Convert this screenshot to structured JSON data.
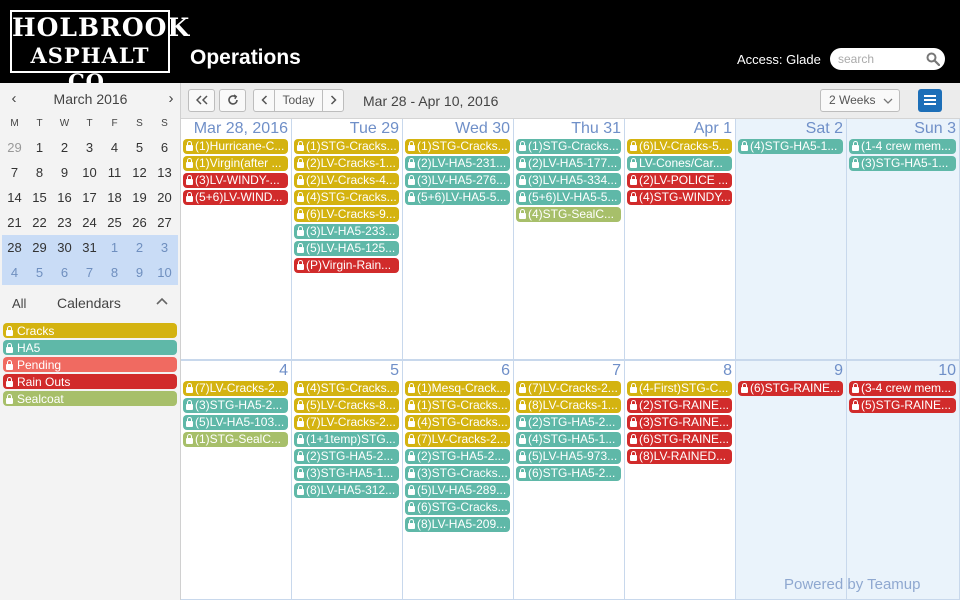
{
  "header": {
    "logo_line1": "HOLBROOK",
    "logo_line2": "ASPHALT CO.",
    "app_title": "Operations",
    "access_label": "Access: Glade",
    "search_placeholder": "search"
  },
  "colors": {
    "header_bg": "#000000",
    "primary": "#1d6fb8",
    "Cracks": "#d4b310",
    "HA5": "#5fb8a8",
    "Pending": "#f06a61",
    "Rain Outs": "#d12b2b",
    "Sealcoat": "#a7bf6a",
    "weekend_bg": "#eaf3fb",
    "day_number": "#6f8fc8"
  },
  "mini_calendar": {
    "prev_icon": "chevron-left-icon",
    "next_icon": "chevron-right-icon",
    "title": "March 2016",
    "days_of_week": [
      "M",
      "T",
      "W",
      "T",
      "F",
      "S",
      "S"
    ],
    "weeks": [
      [
        "29",
        "1",
        "2",
        "3",
        "4",
        "5",
        "6"
      ],
      [
        "7",
        "8",
        "9",
        "10",
        "11",
        "12",
        "13"
      ],
      [
        "14",
        "15",
        "16",
        "17",
        "18",
        "19",
        "20"
      ],
      [
        "21",
        "22",
        "23",
        "24",
        "25",
        "26",
        "27"
      ],
      [
        "28",
        "29",
        "30",
        "31",
        "1",
        "2",
        "3"
      ],
      [
        "4",
        "5",
        "6",
        "7",
        "8",
        "9",
        "10"
      ]
    ],
    "selected_weeks": [
      4,
      5
    ]
  },
  "calendars": {
    "all_label": "All",
    "title": "Calendars",
    "items": [
      {
        "name": "Cracks",
        "color": "#d4b310"
      },
      {
        "name": "HA5",
        "color": "#5fb8a8"
      },
      {
        "name": "Pending",
        "color": "#f06a61"
      },
      {
        "name": "Rain Outs",
        "color": "#d12b2b"
      },
      {
        "name": "Sealcoat",
        "color": "#a7bf6a"
      }
    ]
  },
  "toolbar": {
    "first_icon": "double-chevron-left-icon",
    "refresh_icon": "refresh-icon",
    "prev_icon": "chevron-left-icon",
    "today_label": "Today",
    "next_icon": "chevron-right-icon",
    "date_range": "Mar 28 - Apr 10, 2016",
    "view_label": "2 Weeks",
    "menu_icon": "hamburger-menu-icon"
  },
  "days": [
    {
      "label": "Mar 28, 2016",
      "weekend": false,
      "events": [
        {
          "text": "(1)Hurricane-C...",
          "cal": "Cracks"
        },
        {
          "text": "(1)Virgin(after ...",
          "cal": "Cracks"
        },
        {
          "text": "(3)LV-WINDY-...",
          "cal": "Rain Outs"
        },
        {
          "text": "(5+6)LV-WIND...",
          "cal": "Rain Outs"
        }
      ]
    },
    {
      "label": "Tue 29",
      "weekend": false,
      "events": [
        {
          "text": "(1)STG-Cracks...",
          "cal": "Cracks"
        },
        {
          "text": "(2)LV-Cracks-1...",
          "cal": "Cracks"
        },
        {
          "text": "(2)LV-Cracks-4...",
          "cal": "Cracks"
        },
        {
          "text": "(4)STG-Cracks...",
          "cal": "Cracks"
        },
        {
          "text": "(6)LV-Cracks-9...",
          "cal": "Cracks"
        },
        {
          "text": "(3)LV-HA5-233...",
          "cal": "HA5"
        },
        {
          "text": "(5)LV-HA5-125...",
          "cal": "HA5"
        },
        {
          "text": "(P)Virgin-Rain...",
          "cal": "Rain Outs"
        }
      ]
    },
    {
      "label": "Wed 30",
      "weekend": false,
      "events": [
        {
          "text": "(1)STG-Cracks...",
          "cal": "Cracks"
        },
        {
          "text": "(2)LV-HA5-231...",
          "cal": "HA5"
        },
        {
          "text": "(3)LV-HA5-276...",
          "cal": "HA5"
        },
        {
          "text": "(5+6)LV-HA5-5...",
          "cal": "HA5"
        }
      ]
    },
    {
      "label": "Thu 31",
      "weekend": false,
      "events": [
        {
          "text": "(1)STG-Cracks...",
          "cal": "HA5"
        },
        {
          "text": "(2)LV-HA5-177...",
          "cal": "HA5"
        },
        {
          "text": "(3)LV-HA5-334...",
          "cal": "HA5"
        },
        {
          "text": "(5+6)LV-HA5-5...",
          "cal": "HA5"
        },
        {
          "text": "(4)STG-SealC...",
          "cal": "Sealcoat"
        }
      ]
    },
    {
      "label": "Apr 1",
      "weekend": false,
      "events": [
        {
          "text": "(6)LV-Cracks-5...",
          "cal": "Cracks"
        },
        {
          "text": "LV-Cones/Car...",
          "cal": "HA5"
        },
        {
          "text": "(2)LV-POLICE ...",
          "cal": "Rain Outs"
        },
        {
          "text": "(4)STG-WINDY...",
          "cal": "Rain Outs"
        }
      ]
    },
    {
      "label": "Sat 2",
      "weekend": true,
      "events": [
        {
          "text": "(4)STG-HA5-1...",
          "cal": "HA5"
        }
      ]
    },
    {
      "label": "Sun 3",
      "weekend": true,
      "events": [
        {
          "text": "(1-4 crew mem...",
          "cal": "HA5"
        },
        {
          "text": "(3)STG-HA5-1...",
          "cal": "HA5"
        }
      ]
    },
    {
      "label": "4",
      "weekend": false,
      "events": [
        {
          "text": "(7)LV-Cracks-2...",
          "cal": "Cracks"
        },
        {
          "text": "(3)STG-HA5-2...",
          "cal": "HA5"
        },
        {
          "text": "(5)LV-HA5-103...",
          "cal": "HA5"
        },
        {
          "text": "(1)STG-SealC...",
          "cal": "Sealcoat"
        }
      ]
    },
    {
      "label": "5",
      "weekend": false,
      "events": [
        {
          "text": "(4)STG-Cracks...",
          "cal": "Cracks"
        },
        {
          "text": "(5)LV-Cracks-8...",
          "cal": "Cracks"
        },
        {
          "text": "(7)LV-Cracks-2...",
          "cal": "Cracks"
        },
        {
          "text": "(1+1temp)STG...",
          "cal": "HA5"
        },
        {
          "text": "(2)STG-HA5-2...",
          "cal": "HA5"
        },
        {
          "text": "(3)STG-HA5-1...",
          "cal": "HA5"
        },
        {
          "text": "(8)LV-HA5-312...",
          "cal": "HA5"
        }
      ]
    },
    {
      "label": "6",
      "weekend": false,
      "events": [
        {
          "text": "(1)Mesq-Crack...",
          "cal": "Cracks"
        },
        {
          "text": "(1)STG-Cracks...",
          "cal": "Cracks"
        },
        {
          "text": "(4)STG-Cracks...",
          "cal": "Cracks"
        },
        {
          "text": "(7)LV-Cracks-2...",
          "cal": "Cracks"
        },
        {
          "text": "(2)STG-HA5-2...",
          "cal": "HA5"
        },
        {
          "text": "(3)STG-Cracks...",
          "cal": "HA5"
        },
        {
          "text": "(5)LV-HA5-289...",
          "cal": "HA5"
        },
        {
          "text": "(6)STG-Cracks...",
          "cal": "HA5"
        },
        {
          "text": "(8)LV-HA5-209...",
          "cal": "HA5"
        }
      ]
    },
    {
      "label": "7",
      "weekend": false,
      "events": [
        {
          "text": "(7)LV-Cracks-2...",
          "cal": "Cracks"
        },
        {
          "text": "(8)LV-Cracks-1...",
          "cal": "Cracks"
        },
        {
          "text": "(2)STG-HA5-2...",
          "cal": "HA5"
        },
        {
          "text": "(4)STG-HA5-1...",
          "cal": "HA5"
        },
        {
          "text": "(5)LV-HA5-973...",
          "cal": "HA5"
        },
        {
          "text": "(6)STG-HA5-2...",
          "cal": "HA5"
        }
      ]
    },
    {
      "label": "8",
      "weekend": false,
      "events": [
        {
          "text": "(4-First)STG-C...",
          "cal": "Cracks"
        },
        {
          "text": "(2)STG-RAINE...",
          "cal": "Rain Outs"
        },
        {
          "text": "(3)STG-RAINE...",
          "cal": "Rain Outs"
        },
        {
          "text": "(6)STG-RAINE...",
          "cal": "Rain Outs"
        },
        {
          "text": "(8)LV-RAINED...",
          "cal": "Rain Outs"
        }
      ]
    },
    {
      "label": "9",
      "weekend": true,
      "events": [
        {
          "text": "(6)STG-RAINE...",
          "cal": "Rain Outs"
        }
      ]
    },
    {
      "label": "10",
      "weekend": true,
      "events": [
        {
          "text": "(3-4 crew mem...",
          "cal": "Rain Outs"
        },
        {
          "text": "(5)STG-RAINE...",
          "cal": "Rain Outs"
        }
      ]
    }
  ],
  "footer": {
    "powered_by": "Powered by Teamup"
  }
}
